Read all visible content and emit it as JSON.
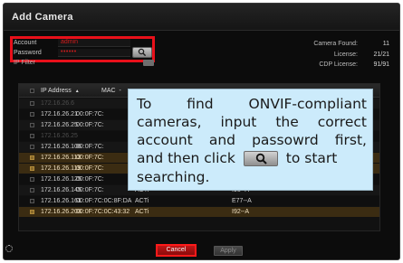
{
  "dialog": {
    "title": "Add Camera"
  },
  "credentials": {
    "account_label": "Account",
    "account_value": "admin",
    "password_label": "Password",
    "password_value": "••••••",
    "ip_filter_label": "IP Filter",
    "search_icon": "search-icon"
  },
  "stats": {
    "camera_found_label": "Camera Found:",
    "camera_found_value": "11",
    "license_label": "License:",
    "license_value": "21/21",
    "cdp_label": "CDP License:",
    "cdp_value": "91/91"
  },
  "table": {
    "headers": {
      "ip": "IP Address",
      "sort_icon": "▲",
      "mac": "MAC",
      "mac_sort": "-"
    },
    "rows": [
      {
        "ip": "172.16.26.6",
        "mac": "",
        "vendor": "",
        "model": "",
        "state": "dim"
      },
      {
        "ip": "172.16.26.21",
        "mac": "00:0F:7C:",
        "vendor": "",
        "model": "",
        "state": "normal"
      },
      {
        "ip": "172.16.26.25",
        "mac": "00:0F:7C:",
        "vendor": "",
        "model": "",
        "state": "normal"
      },
      {
        "ip": "172.16.26.25",
        "mac": "",
        "vendor": "",
        "model": "",
        "state": "dim"
      },
      {
        "ip": "172.16.26.106",
        "mac": "00:0F:7C:",
        "vendor": "",
        "model": "",
        "state": "normal"
      },
      {
        "ip": "172.16.26.113",
        "mac": "00:0F:7C:",
        "vendor": "",
        "model": "",
        "state": "selected"
      },
      {
        "ip": "172.16.26.119",
        "mac": "00:0F:7C:",
        "vendor": "",
        "model": "",
        "state": "selected"
      },
      {
        "ip": "172.16.26.125",
        "mac": "00:0F:7C:",
        "vendor": "",
        "model": "",
        "state": "normal"
      },
      {
        "ip": "172.16.26.145",
        "mac": "00:0F:7C:",
        "vendor": "ACTi",
        "model": "I93--A",
        "state": "normal"
      },
      {
        "ip": "172.16.26.161",
        "mac": "00:0F:7C:0C:8F:DA",
        "vendor": "ACTi",
        "model": "E77--A",
        "state": "normal"
      },
      {
        "ip": "172.16.26.203",
        "mac": "00:0F:7C:0C:43:32",
        "vendor": "ACTi",
        "model": "I92--A",
        "state": "selected"
      }
    ]
  },
  "callout": {
    "line1": [
      "To",
      "find",
      "ONVIF-compliant"
    ],
    "line2": [
      "cameras,",
      "input",
      "the",
      "correct"
    ],
    "line3": [
      "account",
      "and",
      "passowrd",
      "first,"
    ],
    "line4_before": "and then click",
    "line4_after": "to start",
    "line5": "searching."
  },
  "footer": {
    "cancel_label": "Cancel",
    "apply_label": "Apply"
  },
  "colors": {
    "highlight": "#e8101a",
    "callout_bg": "#ccebfb"
  }
}
